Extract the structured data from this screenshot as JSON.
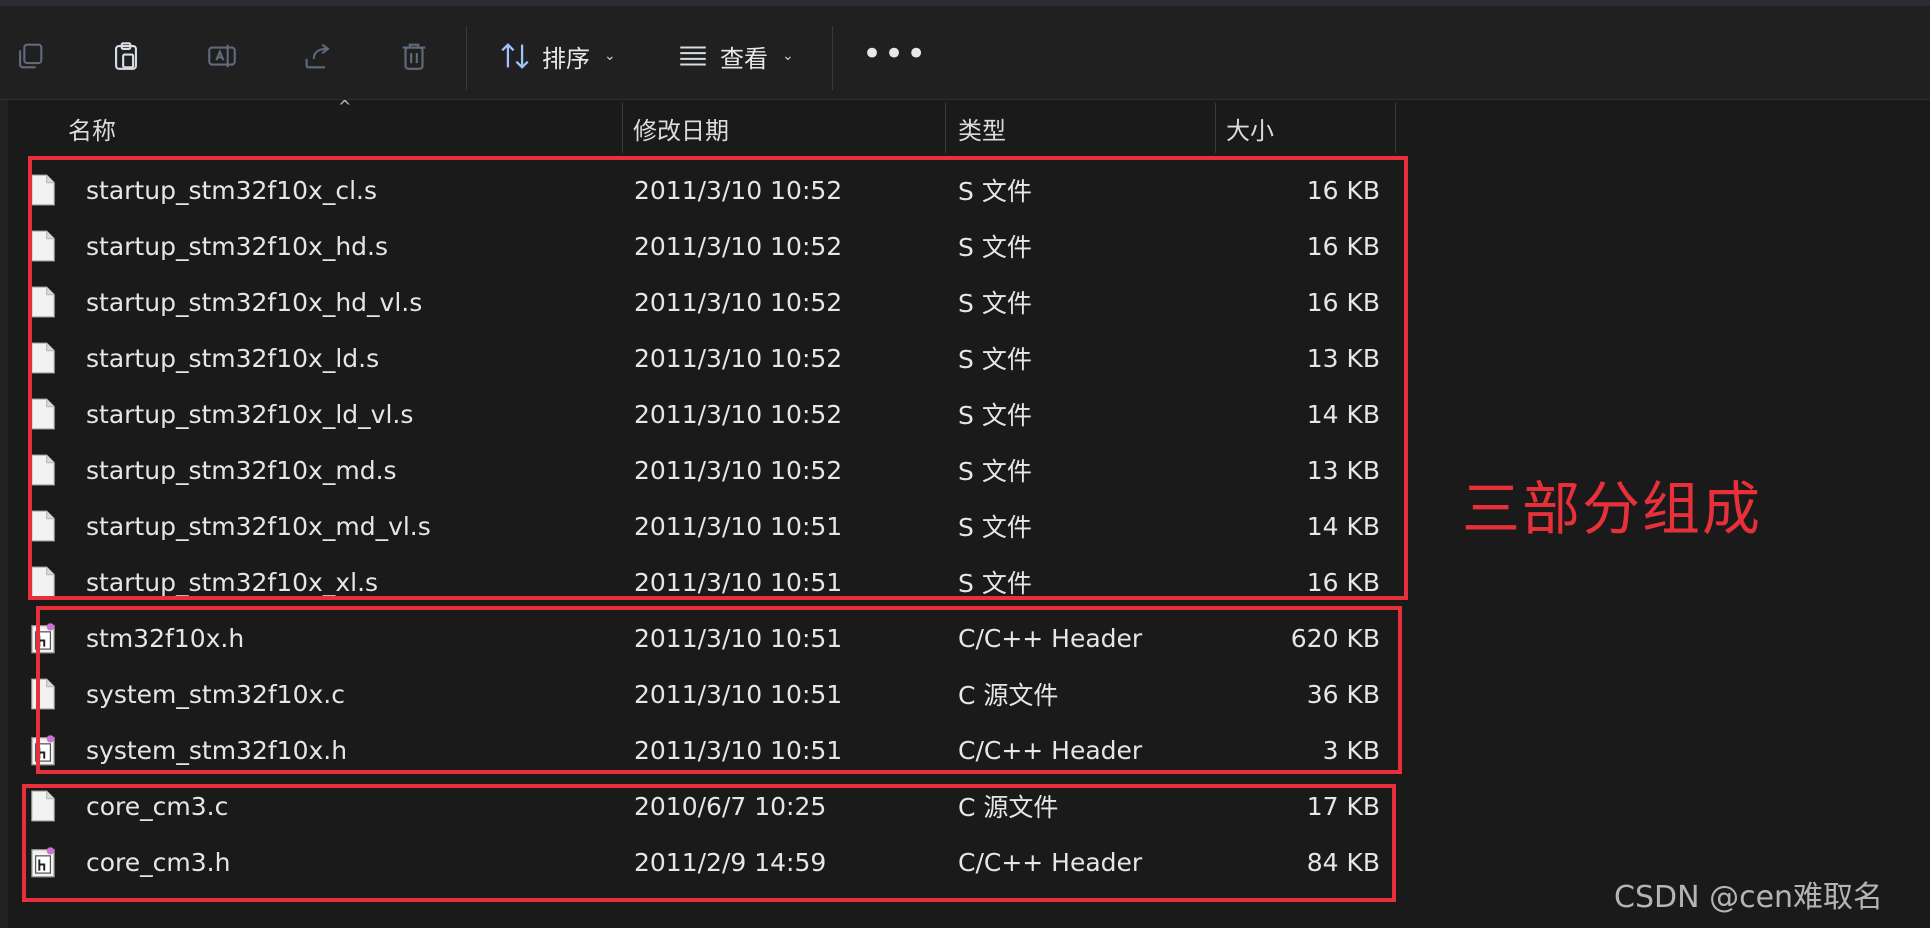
{
  "toolbar": {
    "sort_label": "排序",
    "view_label": "查看",
    "more_label": "•••"
  },
  "columns": {
    "name": "名称",
    "date": "修改日期",
    "type": "类型",
    "size": "大小"
  },
  "files": [
    {
      "name": "startup_stm32f10x_cl.s",
      "date": "2011/3/10 10:52",
      "type": "S 文件",
      "size": "16 KB",
      "icon": "file-icon"
    },
    {
      "name": "startup_stm32f10x_hd.s",
      "date": "2011/3/10 10:52",
      "type": "S 文件",
      "size": "16 KB",
      "icon": "file-icon"
    },
    {
      "name": "startup_stm32f10x_hd_vl.s",
      "date": "2011/3/10 10:52",
      "type": "S 文件",
      "size": "16 KB",
      "icon": "file-icon"
    },
    {
      "name": "startup_stm32f10x_ld.s",
      "date": "2011/3/10 10:52",
      "type": "S 文件",
      "size": "13 KB",
      "icon": "file-icon"
    },
    {
      "name": "startup_stm32f10x_ld_vl.s",
      "date": "2011/3/10 10:52",
      "type": "S 文件",
      "size": "14 KB",
      "icon": "file-icon"
    },
    {
      "name": "startup_stm32f10x_md.s",
      "date": "2011/3/10 10:52",
      "type": "S 文件",
      "size": "13 KB",
      "icon": "file-icon"
    },
    {
      "name": "startup_stm32f10x_md_vl.s",
      "date": "2011/3/10 10:51",
      "type": "S 文件",
      "size": "14 KB",
      "icon": "file-icon"
    },
    {
      "name": "startup_stm32f10x_xl.s",
      "date": "2011/3/10 10:51",
      "type": "S 文件",
      "size": "16 KB",
      "icon": "file-icon"
    },
    {
      "name": "stm32f10x.h",
      "date": "2011/3/10 10:51",
      "type": "C/C++ Header",
      "size": "620 KB",
      "icon": "header-file-icon"
    },
    {
      "name": "system_stm32f10x.c",
      "date": "2011/3/10 10:51",
      "type": "C 源文件",
      "size": "36 KB",
      "icon": "file-icon"
    },
    {
      "name": "system_stm32f10x.h",
      "date": "2011/3/10 10:51",
      "type": "C/C++ Header",
      "size": "3 KB",
      "icon": "header-file-icon"
    },
    {
      "name": "core_cm3.c",
      "date": "2010/6/7 10:25",
      "type": "C 源文件",
      "size": "17 KB",
      "icon": "file-icon"
    },
    {
      "name": "core_cm3.h",
      "date": "2011/2/9 14:59",
      "type": "C/C++ Header",
      "size": "84 KB",
      "icon": "header-file-icon"
    }
  ],
  "annotation": "三部分组成",
  "watermark": "CSDN @cen难取名",
  "colors": {
    "highlight": "#e8303a",
    "background": "#1c1c1c"
  }
}
